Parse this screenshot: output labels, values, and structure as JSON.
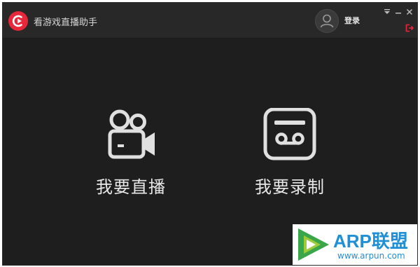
{
  "window": {
    "title": "看游戏直播助手",
    "login_label": "登录"
  },
  "icons": {
    "app_logo": "app-logo-icon",
    "avatar": "user-avatar-icon",
    "dropdown": "dropdown-arrow-icon",
    "minimize": "minimize-icon",
    "close": "close-icon",
    "exit": "exit-icon",
    "live": "video-camera-icon",
    "record": "cassette-tape-icon"
  },
  "main": {
    "actions": [
      {
        "label": "我要直播",
        "icon": "video-camera-icon"
      },
      {
        "label": "我要录制",
        "icon": "cassette-tape-icon"
      }
    ]
  },
  "watermark": {
    "title": "ARP联盟",
    "url": "www.arpun.com"
  },
  "colors": {
    "background": "#1e1e1e",
    "titlebar": "#282828",
    "brand_red": "#e8283a",
    "icon_light": "#e0e0e0",
    "watermark_blue": "#1f8fd6"
  }
}
